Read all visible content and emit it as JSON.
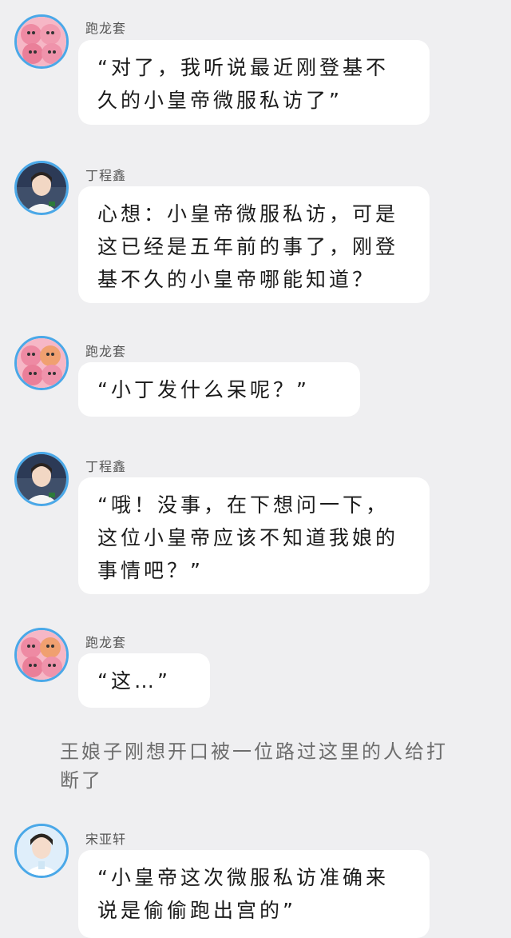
{
  "messages": [
    {
      "sender": "跑龙套",
      "avatar": "pink-plush-avatar",
      "text": "“对了，我听说最近刚登基不久的小皇帝微服私访了”"
    },
    {
      "sender": "丁程鑫",
      "avatar": "boy-portrait-avatar",
      "text": "心想：小皇帝微服私访，可是这已经是五年前的事了，刚登基不久的小皇帝哪能知道？"
    },
    {
      "sender": "跑龙套",
      "avatar": "pink-plush-avatar",
      "text": "“小丁发什么呆呢？”"
    },
    {
      "sender": "丁程鑫",
      "avatar": "boy-portrait-avatar",
      "text": "“哦！没事，在下想问一下，这位小皇帝应该不知道我娘的事情吧？”"
    },
    {
      "sender": "跑龙套",
      "avatar": "pink-plush-avatar",
      "text": "“这…”"
    }
  ],
  "narration": "王娘子刚想开口被一位路过这里的人给打断了",
  "last_message": {
    "sender": "宋亚轩",
    "avatar": "white-shirt-boy-avatar",
    "text": "“小皇帝这次微服私访准确来说是偷偷跑出宫的”"
  },
  "colors": {
    "background": "#efeff1",
    "bubble": "#ffffff",
    "avatar_border": "#4aa8e8"
  }
}
